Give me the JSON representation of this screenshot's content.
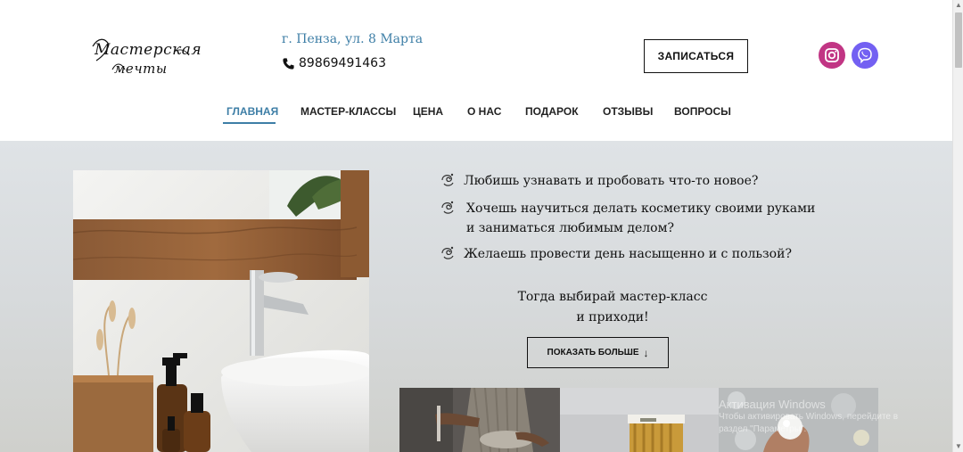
{
  "header": {
    "logo_line1": "Мастерская",
    "logo_line2": "мечты",
    "address": "г. Пенза, ул. 8 Марта",
    "phone": "89869491463",
    "signup_label": "ЗАПИСАТЬСЯ",
    "social": [
      {
        "name": "instagram-icon",
        "color": "#c13584"
      },
      {
        "name": "viber-icon",
        "color": "#7360f2"
      }
    ]
  },
  "nav": {
    "items": [
      {
        "label": "ГЛАВНАЯ",
        "active": true
      },
      {
        "label": "МАСТЕР-КЛАССЫ",
        "active": false
      },
      {
        "label": "ЦЕНА",
        "active": false
      },
      {
        "label": "О НАС",
        "active": false
      },
      {
        "label": "ПОДАРОК",
        "active": false
      },
      {
        "label": "ОТЗЫВЫ",
        "active": false
      },
      {
        "label": "ВОПРОСЫ",
        "active": false
      }
    ]
  },
  "hero": {
    "questions": [
      {
        "line1": "Любишь узнавать и пробовать что-то новое?",
        "line2": ""
      },
      {
        "line1": "Хочешь научиться делать косметику своими руками",
        "line2": "и заниматься любимым делом?"
      },
      {
        "line1": "Желаешь провести день насыщенно и с пользой?",
        "line2": ""
      }
    ],
    "cta_line1": "Тогда выбирай мастер-класс",
    "cta_line2": "и приходи!",
    "more_label": "ПОКАЗАТЬ БОЛЬШЕ",
    "more_icon": "arrow-down-icon"
  },
  "overlay": {
    "line1": "Активация Windows",
    "line2": "Чтобы активировать Windows, перейдите в",
    "line3": "раздел \"Параметры\"."
  },
  "colors": {
    "accent": "#3d7ea6",
    "hero_bg": "#d9dcde"
  }
}
